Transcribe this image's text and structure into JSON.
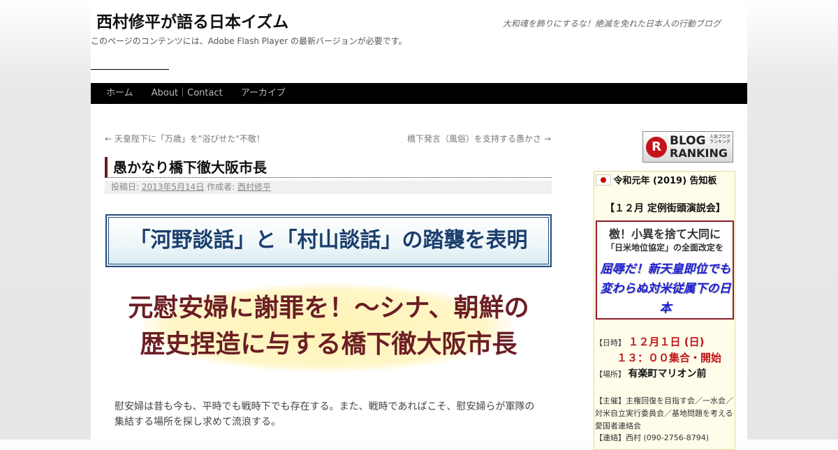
{
  "site": {
    "title": "西村修平が語る日本イズム",
    "description": "大和魂を飾りにするな！絶滅を免れた日本人の行動ブログ",
    "flash_notice": "このページのコンテンツには、Adobe Flash Player の最新バージョンが必要です。"
  },
  "nav": {
    "items": [
      "ホーム",
      "About｜Contact",
      "アーカイブ"
    ]
  },
  "post_nav": {
    "prev": "← 天皇陛下に「万歳」を\"浴びせた\"不敬！",
    "next": "橋下発言（風俗）を支持する愚かさ →"
  },
  "post": {
    "title": "愚かなり橋下徹大阪市長",
    "meta_prefix": "投稿日:",
    "date": "2013年5月14日",
    "author_prefix": "作成者:",
    "author": "西村修平",
    "banner": "「河野談話」と「村山談話」の踏襲を表明",
    "headline_line1": "元慰安婦に謝罪を！〜シナ、朝鮮の",
    "headline_line2": "歴史捏造に与する橋下徹大阪市長",
    "body_line1": "慰安婦は昔も今も、平時でも戦時下でも存在する。また、戦時であればこそ、慰安婦らが軍隊の",
    "body_line2": "集結する場所を探し求めて流浪する。"
  },
  "sidebar": {
    "ranking": {
      "logo_letter": "R",
      "small": "人気ブログランキング",
      "line1": "BLOG",
      "line2": "RANKING"
    },
    "notice": {
      "title": "令和元年 (2019) 告知板",
      "subtitle": "【１２月 定例街頭演説会】",
      "event_line1": "檄！小異を捨て大同に",
      "event_line2": "「日米地位協定」の全面改定を",
      "event_line3": "屈辱だ！新天皇即位でも変わらぬ対米従属下の日本",
      "date_label": "【日時】",
      "date_value": "１２月１日 (日)",
      "time_value": "１３：００集合・開始",
      "place_label": "【場所】",
      "place_value": "有楽町マリオン前",
      "organizer_label": "【主催】",
      "organizer_value": "主権回復を目指す会／一水会／対米自立実行委員会／基地問題を考える愛国者連絡会",
      "contact_label": "【連絡】",
      "contact_value": "西村 (090-2756-8794)"
    }
  }
}
